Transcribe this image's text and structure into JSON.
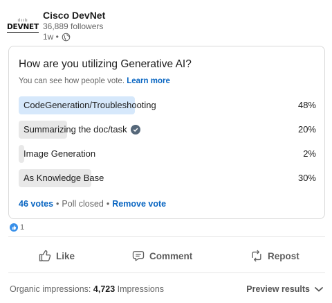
{
  "org": {
    "name": "Cisco DevNet",
    "logo_text": "DEVNET",
    "logo_mark": "ılıılı",
    "followers": "36,889 followers",
    "time": "1w •"
  },
  "poll": {
    "question": "How are you utilizing Generative AI?",
    "visibility_text": "You can see how people vote.",
    "learn_more": "Learn more",
    "options": [
      {
        "label": "CodeGeneration/Troubleshooting",
        "percent": "48%",
        "share": 0.48,
        "winner": true,
        "voted": false
      },
      {
        "label": "Summarizing the doc/task",
        "percent": "20%",
        "share": 0.2,
        "winner": false,
        "voted": true
      },
      {
        "label": "Image Generation",
        "percent": "2%",
        "share": 0.02,
        "winner": false,
        "voted": false
      },
      {
        "label": "As Knowledge Base",
        "percent": "30%",
        "share": 0.3,
        "winner": false,
        "voted": false
      }
    ],
    "votes": "46 votes",
    "sep1": "•",
    "status": "Poll closed",
    "sep2": "•",
    "remove_vote": "Remove vote"
  },
  "reactions": {
    "count": "1",
    "icon": "like-reaction-icon"
  },
  "actions": {
    "like": "Like",
    "comment": "Comment",
    "repost": "Repost"
  },
  "footer": {
    "impressions_prefix": "Organic impressions:",
    "impressions_count": "4,723",
    "impressions_suffix": "Impressions",
    "preview": "Preview results"
  },
  "colors": {
    "accent": "#0a66c2",
    "winner_bar": "#d6e8fb",
    "bar": "#e8e8e8",
    "text_secondary": "#666666"
  }
}
